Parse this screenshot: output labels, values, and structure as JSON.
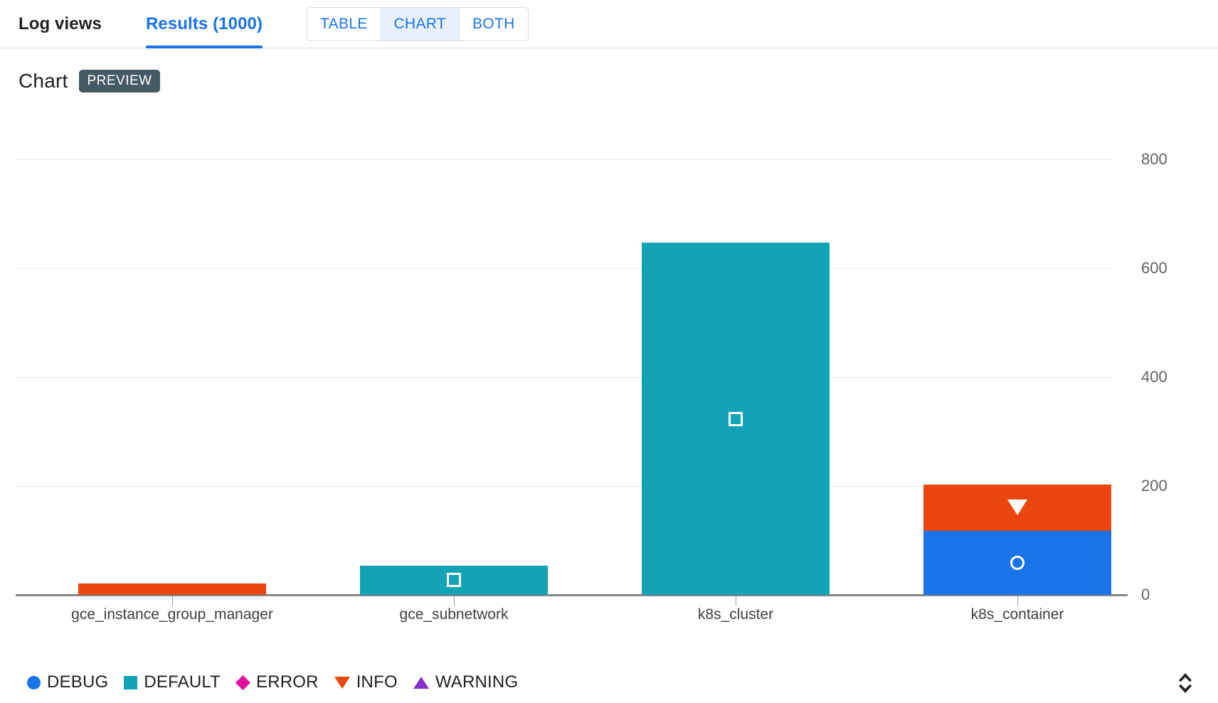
{
  "header": {
    "log_views_label": "Log views",
    "results_label": "Results (1000)",
    "view_modes": [
      {
        "label": "TABLE",
        "selected": false
      },
      {
        "label": "CHART",
        "selected": true
      },
      {
        "label": "BOTH",
        "selected": false
      }
    ]
  },
  "chart_header": {
    "title": "Chart",
    "badge": "PREVIEW"
  },
  "footer": {
    "resize_icon": "unfold-vertical-icon"
  },
  "colors": {
    "debug": "#1a73e8",
    "default": "#12a3b4",
    "error": "#e0119d",
    "info": "#e8450f",
    "warning": "#8430ce",
    "accent": "#1a73e8",
    "badge_bg": "#455a64",
    "axis": "#80868b",
    "grid": "#ececec"
  },
  "chart_data": {
    "type": "bar",
    "stacked": true,
    "title": "Chart",
    "xlabel": "",
    "ylabel": "",
    "ylim": [
      0,
      800
    ],
    "yticks": [
      0,
      200,
      400,
      600,
      800
    ],
    "ytick_labels": [
      "0",
      "200",
      "400",
      "600",
      "800"
    ],
    "grid": true,
    "legend_position": "bottom-left",
    "categories": [
      "gce_instance_group_manager",
      "gce_subnetwork",
      "k8s_cluster",
      "k8s_container"
    ],
    "series": [
      {
        "name": "DEBUG",
        "color": "#1a73e8",
        "marker": "circle",
        "values": [
          0,
          0,
          0,
          118
        ]
      },
      {
        "name": "DEFAULT",
        "color": "#12a3b4",
        "marker": "square",
        "values": [
          0,
          54,
          647,
          0
        ]
      },
      {
        "name": "ERROR",
        "color": "#e0119d",
        "marker": "diamond",
        "values": [
          0,
          0,
          0,
          0
        ]
      },
      {
        "name": "INFO",
        "color": "#e8450f",
        "marker": "triangle-down",
        "values": [
          21,
          0,
          0,
          85
        ]
      },
      {
        "name": "WARNING",
        "color": "#8430ce",
        "marker": "triangle-up",
        "values": [
          0,
          0,
          0,
          0
        ]
      }
    ]
  }
}
